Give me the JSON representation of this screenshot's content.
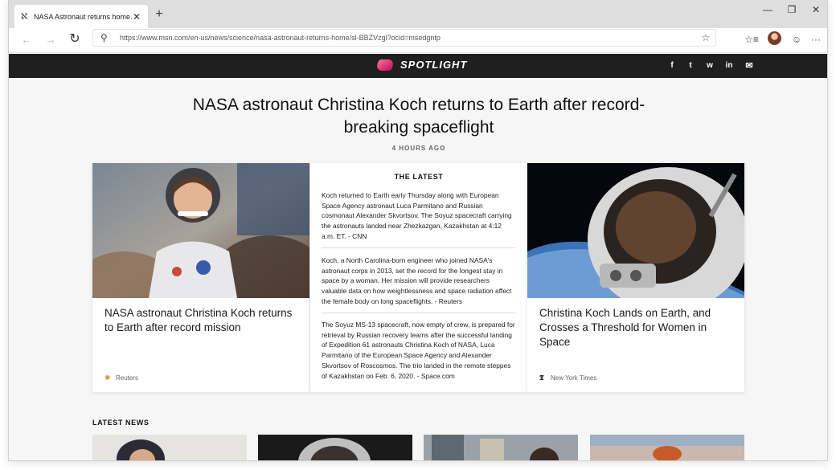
{
  "browser": {
    "tab_title": "NASA Astronaut returns home...",
    "tab_close": "✕",
    "new_tab": "+",
    "url": "https://www.msn.com/en-us/news/science/nasa-astronaut-returns-home/sl-BBZVzgl?ocid=msedgntp",
    "controls": {
      "minimize": "—",
      "restore": "❐",
      "close": "✕"
    }
  },
  "toolbar": {
    "back": "←",
    "forward": "→",
    "refresh": "↻",
    "favorite": "☆",
    "favorites": "☆≡",
    "feedback": "☺",
    "more": "···"
  },
  "spotlight": {
    "brand": "SPOTLIGHT",
    "share": {
      "facebook": "f",
      "twitter": "t",
      "whatsapp": "w",
      "linkedin": "in",
      "email": "✉"
    }
  },
  "article": {
    "headline": "NASA astronaut Christina Koch returns to Earth after record-breaking spaceflight",
    "time_ago": "4 HOURS AGO"
  },
  "cards": [
    {
      "title": "NASA astronaut Christina Koch returns to Earth after record mission",
      "source": "Reuters"
    },
    {
      "title": "Christina Koch Lands on Earth, and Crosses a Threshold for Women in Space",
      "source": "New York Times"
    }
  ],
  "latest": {
    "heading": "THE LATEST",
    "items": [
      "Koch returned to Earth early Thursday along with European Space Agency astronaut Luca Parmitano and Russian cosmonaut Alexander Skvortsov. The Soyuz spacecraft carrying the astronauts landed near Zhezkazgan, Kazakhstan at 4:12 a.m. ET. - CNN",
      "Koch, a North Carolina-born engineer who joined NASA's astronaut corps in 2013, set the record for the longest stay in space by a woman. Her mission will provide researchers valuable data on how weightlessness and space radiation affect the female body on long spaceflights. - Reuters",
      "The Soyuz MS-13 spacecraft, now empty of crew, is prepared for retrieval by Russian recovery teams after the successful landing of Expedition 61 astronauts Christina Koch of NASA, Luca Parmitano of the European Space Agency and Alexander Skvortsov of Roscosmos. The trio landed in the remote steppes of Kazakhstan on Feb. 6, 2020. - Space.com"
    ]
  },
  "latest_news": {
    "heading": "LATEST NEWS"
  }
}
